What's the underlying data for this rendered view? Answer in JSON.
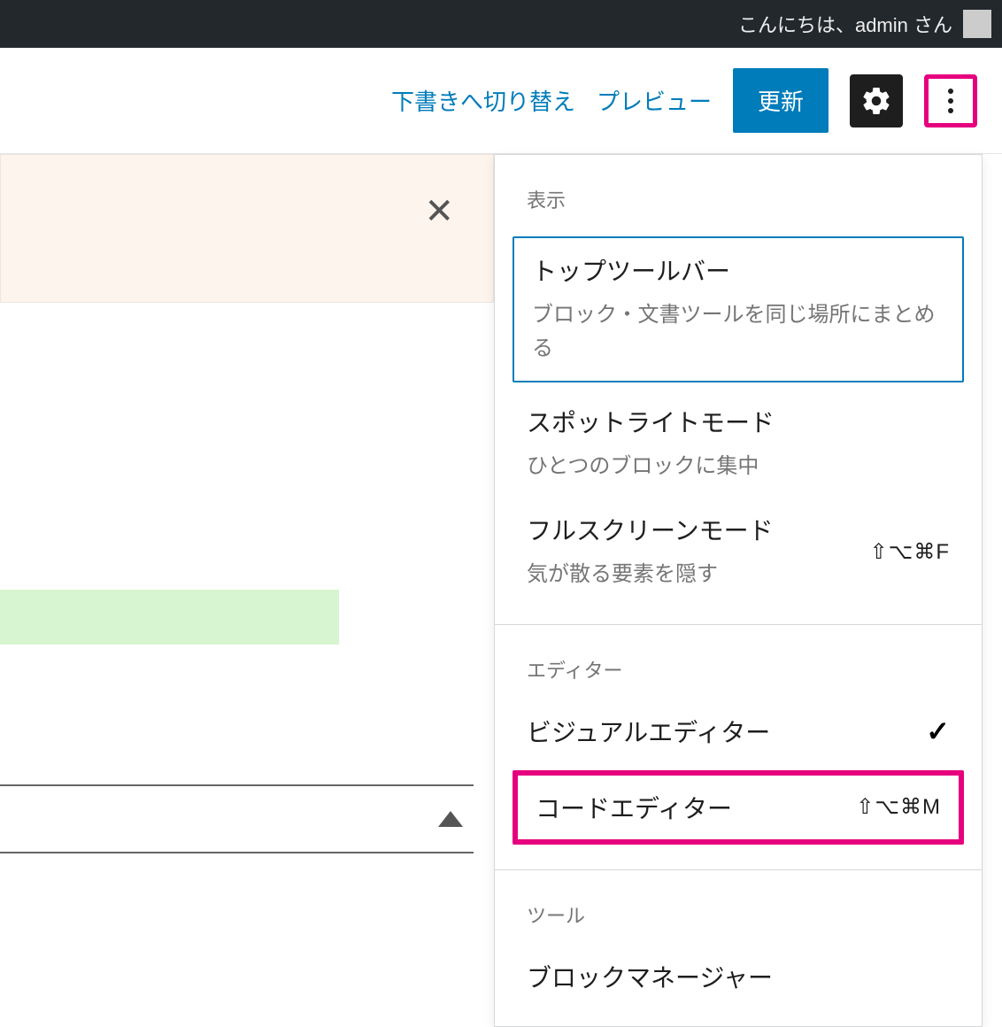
{
  "adminBar": {
    "greeting": "こんにちは、admin さん"
  },
  "header": {
    "switchDraft": "下書きへ切り替え",
    "preview": "プレビュー",
    "update": "更新"
  },
  "menu": {
    "groups": [
      {
        "label": "表示",
        "items": [
          {
            "title": "トップツールバー",
            "desc": "ブロック・文書ツールを同じ場所にまとめる",
            "shortcut": "",
            "selected": true,
            "highlighted": false,
            "checked": false
          },
          {
            "title": "スポットライトモード",
            "desc": "ひとつのブロックに集中",
            "shortcut": "",
            "selected": false,
            "highlighted": false,
            "checked": false
          },
          {
            "title": "フルスクリーンモード",
            "desc": "気が散る要素を隠す",
            "shortcut": "⇧⌥⌘F",
            "selected": false,
            "highlighted": false,
            "checked": false
          }
        ]
      },
      {
        "label": "エディター",
        "items": [
          {
            "title": "ビジュアルエディター",
            "desc": "",
            "shortcut": "",
            "selected": false,
            "highlighted": false,
            "checked": true
          },
          {
            "title": "コードエディター",
            "desc": "",
            "shortcut": "⇧⌥⌘M",
            "selected": false,
            "highlighted": true,
            "checked": false
          }
        ]
      },
      {
        "label": "ツール",
        "items": [
          {
            "title": "ブロックマネージャー",
            "desc": "",
            "shortcut": "",
            "selected": false,
            "highlighted": false,
            "checked": false
          }
        ]
      }
    ]
  }
}
